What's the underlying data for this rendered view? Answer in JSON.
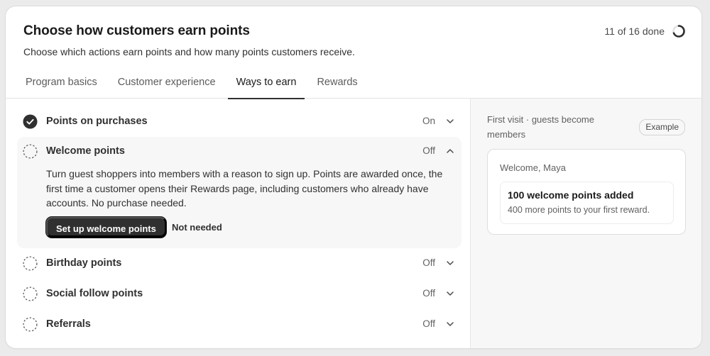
{
  "header": {
    "title": "Choose how customers earn points",
    "subtitle": "Choose which actions earn points and how many points customers receive.",
    "progress_text": "11 of 16 done",
    "progress_fraction": 0.6875
  },
  "tabs": [
    {
      "label": "Program basics",
      "active": false
    },
    {
      "label": "Customer experience",
      "active": false
    },
    {
      "label": "Ways to earn",
      "active": true
    },
    {
      "label": "Rewards",
      "active": false
    }
  ],
  "earn_list": {
    "purchases": {
      "label": "Points on purchases",
      "status": "On",
      "icon": "check-circle-icon"
    },
    "welcome": {
      "label": "Welcome points",
      "status": "Off",
      "icon": "dashed-circle-icon",
      "description": "Turn guest shoppers into members with a reason to sign up. Points are awarded once, the first time a customer opens their Rewards page, including customers who already have accounts. No purchase needed.",
      "primary_button": "Set up welcome points",
      "secondary_button": "Not needed"
    },
    "birthday": {
      "label": "Birthday points",
      "status": "Off",
      "icon": "dashed-circle-icon"
    },
    "social": {
      "label": "Social follow points",
      "status": "Off",
      "icon": "dashed-circle-icon"
    },
    "referrals": {
      "label": "Referrals",
      "status": "Off",
      "icon": "dashed-circle-icon"
    }
  },
  "preview": {
    "title": "First visit · guests become members",
    "badge": "Example",
    "greeting": "Welcome, Maya",
    "notice_title": "100 welcome points added",
    "notice_sub": "400 more points to your first reward."
  },
  "colors": {
    "primary": "#303030",
    "page_bg": "#ebebeb",
    "panel_bg": "#f7f7f7"
  }
}
